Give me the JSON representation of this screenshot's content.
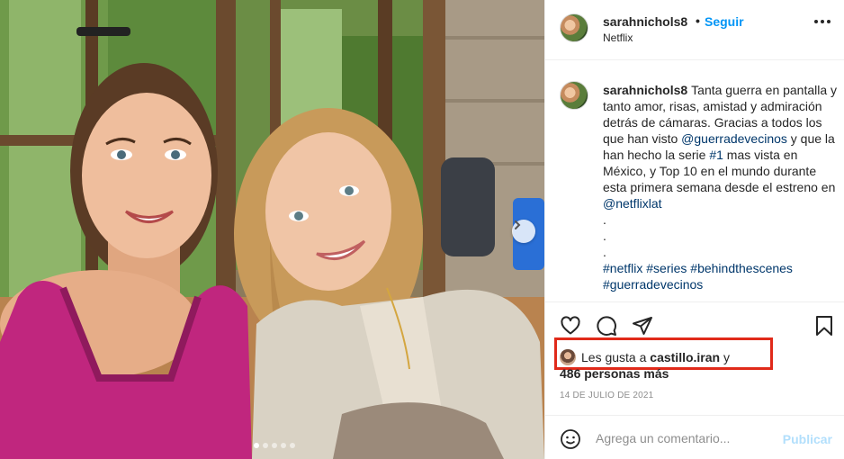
{
  "header": {
    "username": "sarahnichols8",
    "separator": "•",
    "follow_label": "Seguir",
    "location": "Netflix"
  },
  "caption": {
    "username": "sarahnichols8",
    "text_1": "Tanta guerra en pantalla y tanto amor, risas, amistad y admiración detrás de cámaras. Gracias a todos los que han visto ",
    "mention_1": "@guerradevecinos",
    "text_2": " y que la han hecho la serie ",
    "hashtag_1": "#1",
    "text_3": " mas vista en México, y Top 10 en el mundo durante esta primera semana desde el estreno en ",
    "mention_2": "@netflixlat",
    "dot_1": ".",
    "dot_2": ".",
    "dot_3": ".",
    "hashtags": [
      "#netflix",
      "#series",
      "#behindthescenes",
      "#guerradevecinos"
    ]
  },
  "likes": {
    "prefix": "Les gusta a ",
    "user": "castillo.iran",
    "conjunction": " y",
    "others": "486 personas más"
  },
  "date": "14 DE JULIO DE 2021",
  "comment": {
    "placeholder": "Agrega un comentario...",
    "publish_label": "Publicar"
  },
  "colors": {
    "accent": "#0095f6",
    "highlight_box": "#e02a1a",
    "link": "#00376b"
  },
  "icons": {
    "like": "heart-icon",
    "comment": "speech-bubble-icon",
    "share": "paper-plane-icon",
    "save": "bookmark-icon",
    "emoji": "smiley-icon",
    "more": "ellipsis-icon",
    "next": "chevron-right-icon"
  },
  "carousel": {
    "total": 5,
    "active": 1
  }
}
